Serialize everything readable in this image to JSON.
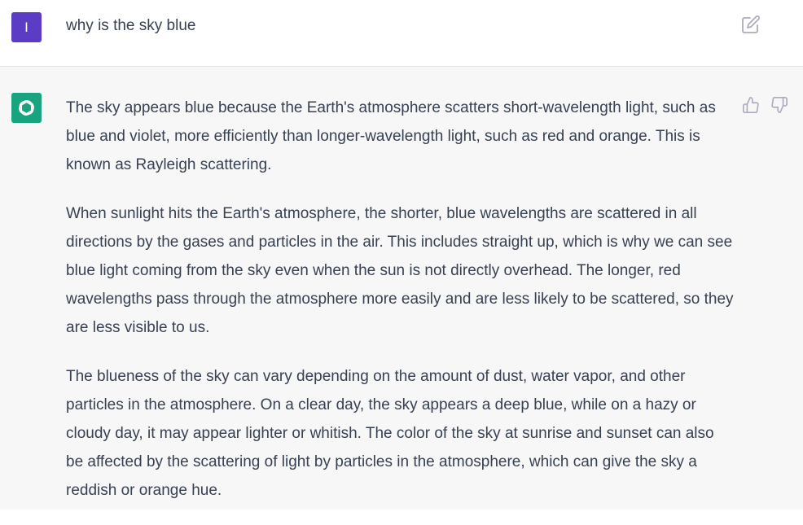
{
  "user_message": {
    "avatar_initial": "I",
    "text": "why is the sky blue"
  },
  "assistant_message": {
    "paragraphs": [
      "The sky appears blue because the Earth's atmosphere scatters short-wavelength light, such as blue and violet, more efficiently than longer-wavelength light, such as red and orange. This is known as Rayleigh scattering.",
      "When sunlight hits the Earth's atmosphere, the shorter, blue wavelengths are scattered in all directions by the gases and particles in the air. This includes straight up, which is why we can see blue light coming from the sky even when the sun is not directly overhead. The longer, red wavelengths pass through the atmosphere more easily and are less likely to be scattered, so they are less visible to us.",
      "The blueness of the sky can vary depending on the amount of dust, water vapor, and other particles in the atmosphere. On a clear day, the sky appears a deep blue, while on a hazy or cloudy day, it may appear lighter or whitish. The color of the sky at sunrise and sunset can also be affected by the scattering of light by particles in the atmosphere, which can give the sky a reddish or orange hue."
    ]
  },
  "icons": {
    "edit": "edit-icon",
    "bot_logo": "openai-logo-icon",
    "thumbs_up": "thumbs-up-icon",
    "thumbs_down": "thumbs-down-icon"
  },
  "colors": {
    "user_avatar": "#5b3cc4",
    "bot_avatar": "#19a37f",
    "assistant_background": "#f7f7f8",
    "text": "#374151",
    "icon": "#acacbe"
  }
}
